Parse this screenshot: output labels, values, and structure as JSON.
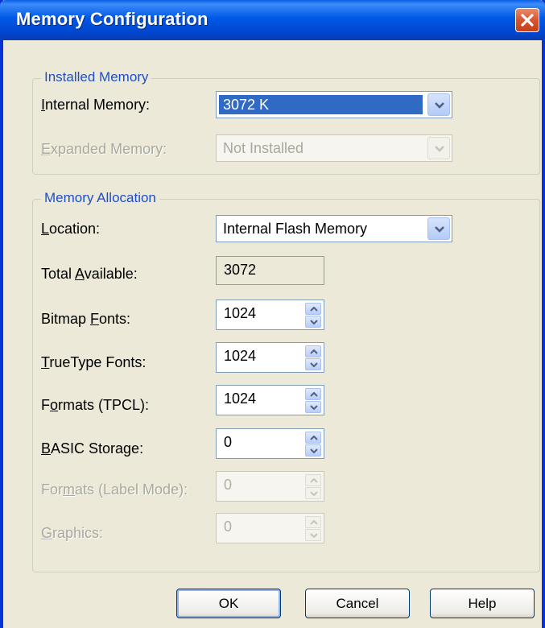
{
  "window": {
    "title": "Memory Configuration",
    "close_glyph": "✕"
  },
  "installed": {
    "legend": "Installed Memory",
    "internal": {
      "label_pre": "",
      "label_acc": "I",
      "label_post": "nternal Memory:",
      "value": "3072 K"
    },
    "expanded": {
      "label_pre": "",
      "label_acc": "E",
      "label_post": "xpanded Memory:",
      "value": "Not Installed"
    }
  },
  "allocation": {
    "legend": "Memory Allocation",
    "location": {
      "label_pre": "",
      "label_acc": "L",
      "label_post": "ocation:",
      "value": "Internal Flash Memory"
    },
    "total": {
      "label_pre": "Total ",
      "label_acc": "A",
      "label_post": "vailable:",
      "value": "3072"
    },
    "bitmap": {
      "label_pre": "Bitmap ",
      "label_acc": "F",
      "label_post": "onts:",
      "value": "1024"
    },
    "truetype": {
      "label_pre": "",
      "label_acc": "T",
      "label_post": "rueType Fonts:",
      "value": "1024"
    },
    "formats_tpcl": {
      "label_pre": "F",
      "label_acc": "o",
      "label_post": "rmats (TPCL):",
      "value": "1024"
    },
    "basic": {
      "label_pre": "",
      "label_acc": "B",
      "label_post": "ASIC Storage:",
      "value": "0"
    },
    "formats_label": {
      "label_pre": "For",
      "label_acc": "m",
      "label_post": "ats (Label Mode):",
      "value": "0"
    },
    "graphics": {
      "label_pre": "",
      "label_acc": "G",
      "label_post": "raphics:",
      "value": "0"
    }
  },
  "buttons": {
    "ok": "OK",
    "cancel": "Cancel",
    "help": "Help"
  },
  "icons": {
    "dropdown": "chevron-down-icon",
    "spin_up": "spin-up-icon",
    "spin_down": "spin-down-icon",
    "close": "close-icon"
  },
  "colors": {
    "title_bar": "#0058e6",
    "face": "#ece9d8",
    "group_title": "#1f4fc8",
    "selection": "#316ac5",
    "close_button": "#d8552e"
  }
}
